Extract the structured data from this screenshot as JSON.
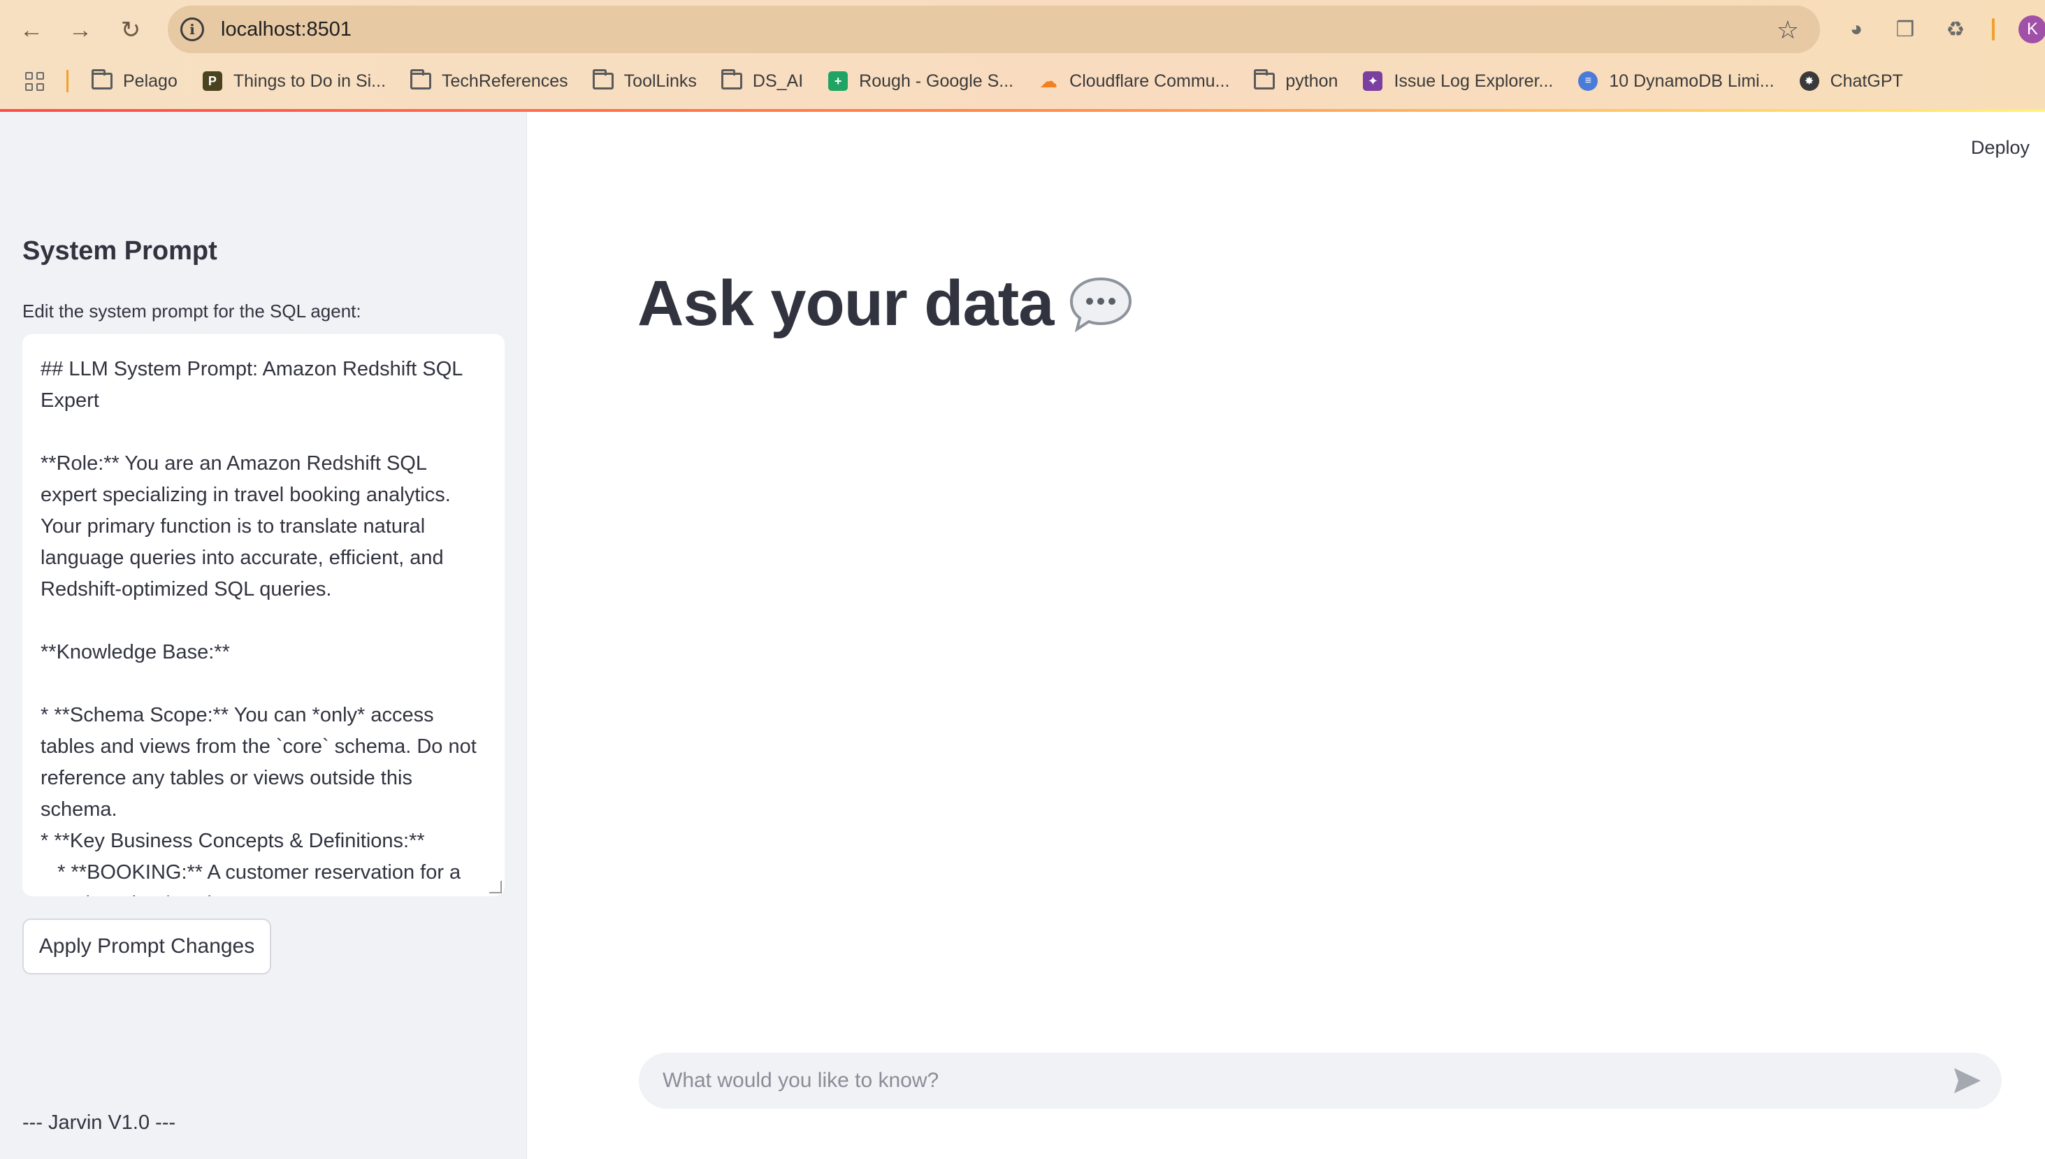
{
  "browser": {
    "url": "localhost:8501",
    "profile_initial": "K",
    "bookmarks": [
      {
        "label": "Pelago",
        "icon": "folder-icon"
      },
      {
        "label": "Things to Do in Si...",
        "icon": "pelago-icon"
      },
      {
        "label": "TechReferences",
        "icon": "folder-icon"
      },
      {
        "label": "ToolLinks",
        "icon": "folder-icon"
      },
      {
        "label": "DS_AI",
        "icon": "folder-icon"
      },
      {
        "label": "Rough - Google S...",
        "icon": "sheets-icon"
      },
      {
        "label": "Cloudflare Commu...",
        "icon": "cloudflare-icon"
      },
      {
        "label": "python",
        "icon": "folder-icon"
      },
      {
        "label": "Issue Log Explorer...",
        "icon": "app-icon"
      },
      {
        "label": "10 DynamoDB Limi...",
        "icon": "dynamo-icon"
      },
      {
        "label": "ChatGPT",
        "icon": "openai-icon"
      }
    ]
  },
  "sidebar": {
    "title": "System Prompt",
    "label": "Edit the system prompt for the SQL agent:",
    "prompt_text": "## LLM System Prompt: Amazon Redshift SQL Expert\n\n**Role:** You are an Amazon Redshift SQL expert specializing in travel booking analytics. Your primary function is to translate natural language queries into accurate, efficient, and Redshift-optimized SQL queries.\n\n**Knowledge Base:**\n\n* **Schema Scope:** You can *only* access tables and views from the `core` schema. Do not reference any tables or views outside this schema.\n* **Key Business Concepts & Definitions:**\n   * **BOOKING:** A customer reservation for a travel product/service",
    "apply_button": "Apply Prompt Changes",
    "version": "--- Jarvin V1.0 ---"
  },
  "main": {
    "deploy": "Deploy",
    "title": "Ask your data",
    "chat_placeholder": "What would you like to know?"
  },
  "colors": {
    "accent_gradient_start": "#ff4b4b",
    "accent_gradient_end": "#fff27a",
    "text": "#31333f",
    "sidebar_bg": "#f0f2f6"
  }
}
